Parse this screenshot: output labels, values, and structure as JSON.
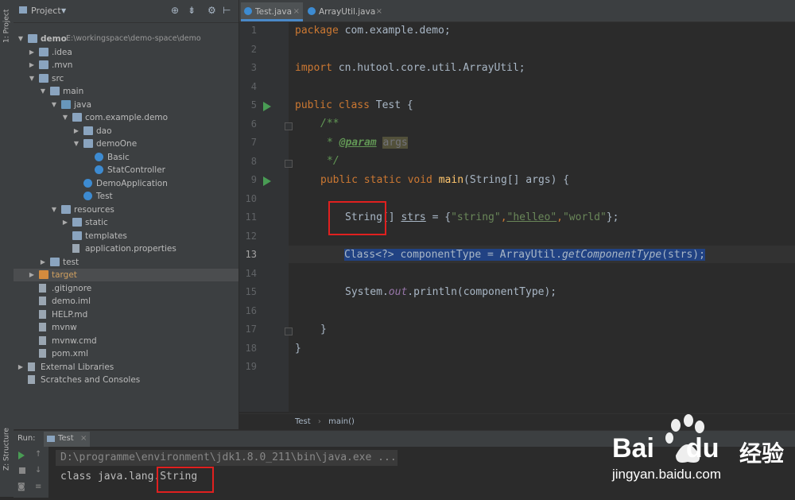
{
  "left_strip": {
    "project_tab": "1: Project",
    "structure_tab": "Z: Structure"
  },
  "project": {
    "header_title": "Project",
    "tree": [
      {
        "label": "demo",
        "detail": "E:\\workingspace\\demo-space\\demo",
        "icon": "module-folder-icon"
      },
      {
        "label": ".idea",
        "icon": "folder-icon"
      },
      {
        "label": ".mvn",
        "icon": "folder-icon"
      },
      {
        "label": "src",
        "icon": "folder-icon"
      },
      {
        "label": "main",
        "icon": "folder-icon"
      },
      {
        "label": "java",
        "icon": "source-folder-icon"
      },
      {
        "label": "com.example.demo",
        "icon": "package-icon"
      },
      {
        "label": "dao",
        "icon": "package-icon"
      },
      {
        "label": "demoOne",
        "icon": "package-icon"
      },
      {
        "label": "Basic",
        "icon": "class-icon"
      },
      {
        "label": "StatController",
        "icon": "class-icon"
      },
      {
        "label": "DemoApplication",
        "icon": "class-icon"
      },
      {
        "label": "Test",
        "icon": "class-icon"
      },
      {
        "label": "resources",
        "icon": "resources-folder-icon"
      },
      {
        "label": "static",
        "icon": "folder-icon"
      },
      {
        "label": "templates",
        "icon": "folder-icon"
      },
      {
        "label": "application.properties",
        "icon": "properties-file-icon"
      },
      {
        "label": "test",
        "icon": "folder-icon"
      },
      {
        "label": "target",
        "icon": "excluded-folder-icon"
      },
      {
        "label": ".gitignore",
        "icon": "file-icon"
      },
      {
        "label": "demo.iml",
        "icon": "file-icon"
      },
      {
        "label": "HELP.md",
        "icon": "markdown-file-icon"
      },
      {
        "label": "mvnw",
        "icon": "file-icon"
      },
      {
        "label": "mvnw.cmd",
        "icon": "file-icon"
      },
      {
        "label": "pom.xml",
        "icon": "maven-file-icon"
      },
      {
        "label": "External Libraries",
        "icon": "libraries-icon"
      },
      {
        "label": "Scratches and Consoles",
        "icon": "scratches-icon"
      }
    ]
  },
  "editor": {
    "tabs": [
      {
        "label": "Test.java"
      },
      {
        "label": "ArrayUtil.java"
      }
    ],
    "line_numbers": [
      "1",
      "2",
      "3",
      "4",
      "5",
      "6",
      "7",
      "8",
      "9",
      "10",
      "11",
      "12",
      "13",
      "14",
      "15",
      "16",
      "17",
      "18",
      "19"
    ],
    "code": {
      "l1_kw": "package",
      "l1_rest": " com.example.demo;",
      "l3_kw": "import",
      "l3_rest": " cn.hutool.core.util.ArrayUtil;",
      "l5_kw": "public class",
      "l5_rest": " Test {",
      "l6": "/**",
      "l7_star": "* ",
      "l7_tag": "@param",
      "l7_param": "args",
      "l8": "*/",
      "l9_kw": "public static void",
      "l9_fn": " main",
      "l9_rest": "(String[] args) {",
      "l11_type": "String",
      "l11_br": "[] ",
      "l11_var": "strs",
      "l11_eq": " = {",
      "l11_s1": "\"string\"",
      "l11_c1": ",",
      "l11_s2": "\"helleo\"",
      "l11_c2": ",",
      "l11_s3": "\"world\"",
      "l11_end": "};",
      "l13_a": "Class<?> componentType = ArrayUtil.",
      "l13_fn": "getComponentType",
      "l13_b": "(strs);",
      "l15_a": "System.",
      "l15_out": "out",
      "l15_b": ".println(componentType);",
      "l17": "}",
      "l18": "}"
    },
    "breadcrumb": [
      "Test",
      "main()"
    ]
  },
  "run": {
    "label": "Run:",
    "tab": "Test",
    "line1": "D:\\programme\\environment\\jdk1.8.0_211\\bin\\java.exe ...",
    "line2_prefix": "class java.lang.",
    "line2_type": "String"
  },
  "watermark": {
    "brand": "Bai",
    "brand2": "du",
    "cn": "经验",
    "url": "jingyan.baidu.com"
  }
}
